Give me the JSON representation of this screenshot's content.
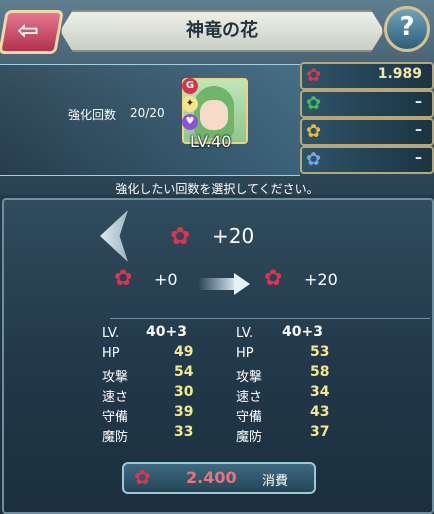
{
  "title": "神竜の花",
  "header": {
    "count_label": "強化回数",
    "count_value": "20/20",
    "level_text": "LV.40"
  },
  "resources": [
    {
      "icon": "red-flower",
      "value": "1.989"
    },
    {
      "icon": "green-flower",
      "value": "–"
    },
    {
      "icon": "gold-flower",
      "value": "–"
    },
    {
      "icon": "blue-flower",
      "value": "–"
    }
  ],
  "instruction": "強化したい回数を選択してください。",
  "selection": {
    "amount": "+20",
    "before": "+0",
    "after": "+20"
  },
  "stats_before": [
    {
      "label": "LV.",
      "value": "40+3"
    },
    {
      "label": "HP",
      "value": "49"
    },
    {
      "label": "攻撃",
      "value": "54"
    },
    {
      "label": "速さ",
      "value": "30"
    },
    {
      "label": "守備",
      "value": "39"
    },
    {
      "label": "魔防",
      "value": "33"
    }
  ],
  "stats_after": [
    {
      "label": "LV.",
      "value": "40+3"
    },
    {
      "label": "HP",
      "value": "53"
    },
    {
      "label": "攻撃",
      "value": "58"
    },
    {
      "label": "速さ",
      "value": "34"
    },
    {
      "label": "守備",
      "value": "43"
    },
    {
      "label": "魔防",
      "value": "37"
    }
  ],
  "cost": {
    "value": "2.400",
    "label": "消費"
  },
  "colors": {
    "red_flower": "#e0334f",
    "stat_value": "#f3e88f",
    "cost_value": "#f06f7e"
  }
}
